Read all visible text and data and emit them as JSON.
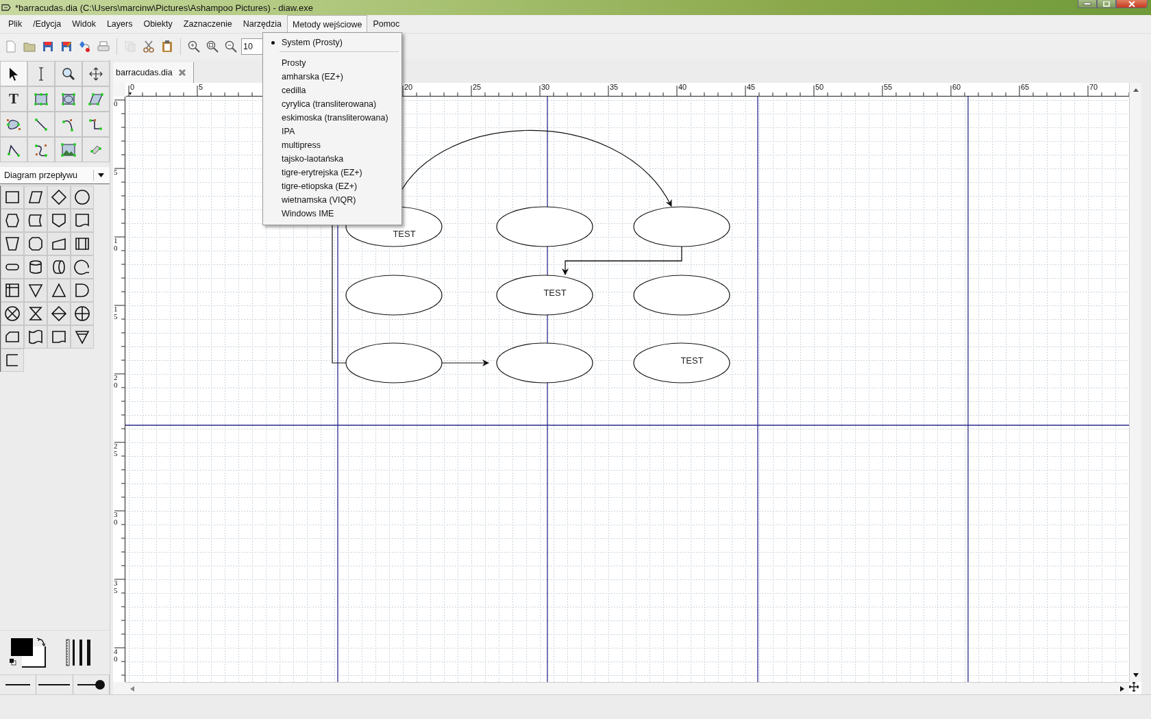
{
  "window": {
    "title": "*barracudas.dia (C:\\Users\\marcinw\\Pictures\\Ashampoo Pictures) - diaw.exe"
  },
  "menu_bar": [
    {
      "label": "Plik",
      "selected": false
    },
    {
      "label": "/Edycja",
      "selected": false
    },
    {
      "label": "Widok",
      "selected": false
    },
    {
      "label": "Layers",
      "selected": false
    },
    {
      "label": "Obiekty",
      "selected": false
    },
    {
      "label": "Zaznaczenie",
      "selected": false
    },
    {
      "label": "Narzędzia",
      "selected": false
    },
    {
      "label": "Metody wejściowe",
      "selected": true
    },
    {
      "label": "Pomoc",
      "selected": false
    }
  ],
  "toolbar": {
    "zoom_value": "10"
  },
  "tabs": [
    {
      "label": "barracudas.dia",
      "selected": true
    }
  ],
  "toolbox": {
    "text_tool": "T"
  },
  "sheet_selector": {
    "value": "Diagram przepływu"
  },
  "rulers": {
    "horizontal": [
      "0",
      "5",
      "20",
      "25",
      "30",
      "35",
      "40",
      "45",
      "50",
      "55",
      "60",
      "65",
      "70"
    ],
    "vertical": [
      "0",
      "5",
      "10",
      "15",
      "20",
      "25",
      "30",
      "35",
      "40"
    ]
  },
  "diagram": {
    "nodes": [
      {
        "kind": "ellipse",
        "label": "TEST"
      },
      {
        "kind": "ellipse"
      },
      {
        "kind": "ellipse"
      },
      {
        "kind": "ellipse"
      },
      {
        "kind": "ellipse",
        "label": "TEST"
      },
      {
        "kind": "ellipse"
      },
      {
        "kind": "ellipse"
      },
      {
        "kind": "ellipse"
      },
      {
        "kind": "ellipse",
        "label": "TEST"
      }
    ]
  },
  "input_methods_menu": {
    "groups": [
      [
        {
          "label": "System (Prosty)",
          "selected": true
        }
      ],
      [
        {
          "label": "Prosty",
          "selected": false
        },
        {
          "label": "amharska (EZ+)",
          "selected": false
        },
        {
          "label": "cedilla",
          "selected": false
        },
        {
          "label": "cyrylica (transliterowana)",
          "selected": false
        },
        {
          "label": "eskimoska (transliterowana)",
          "selected": false
        },
        {
          "label": "IPA",
          "selected": false
        },
        {
          "label": "multipress",
          "selected": false
        },
        {
          "label": "tajsko-laotańska",
          "selected": false
        },
        {
          "label": "tigre-erytrejska (EZ+)",
          "selected": false
        },
        {
          "label": "tigre-etiopska (EZ+)",
          "selected": false
        },
        {
          "label": "wietnamska (VIQR)",
          "selected": false
        },
        {
          "label": "Windows IME",
          "selected": false
        }
      ]
    ]
  }
}
